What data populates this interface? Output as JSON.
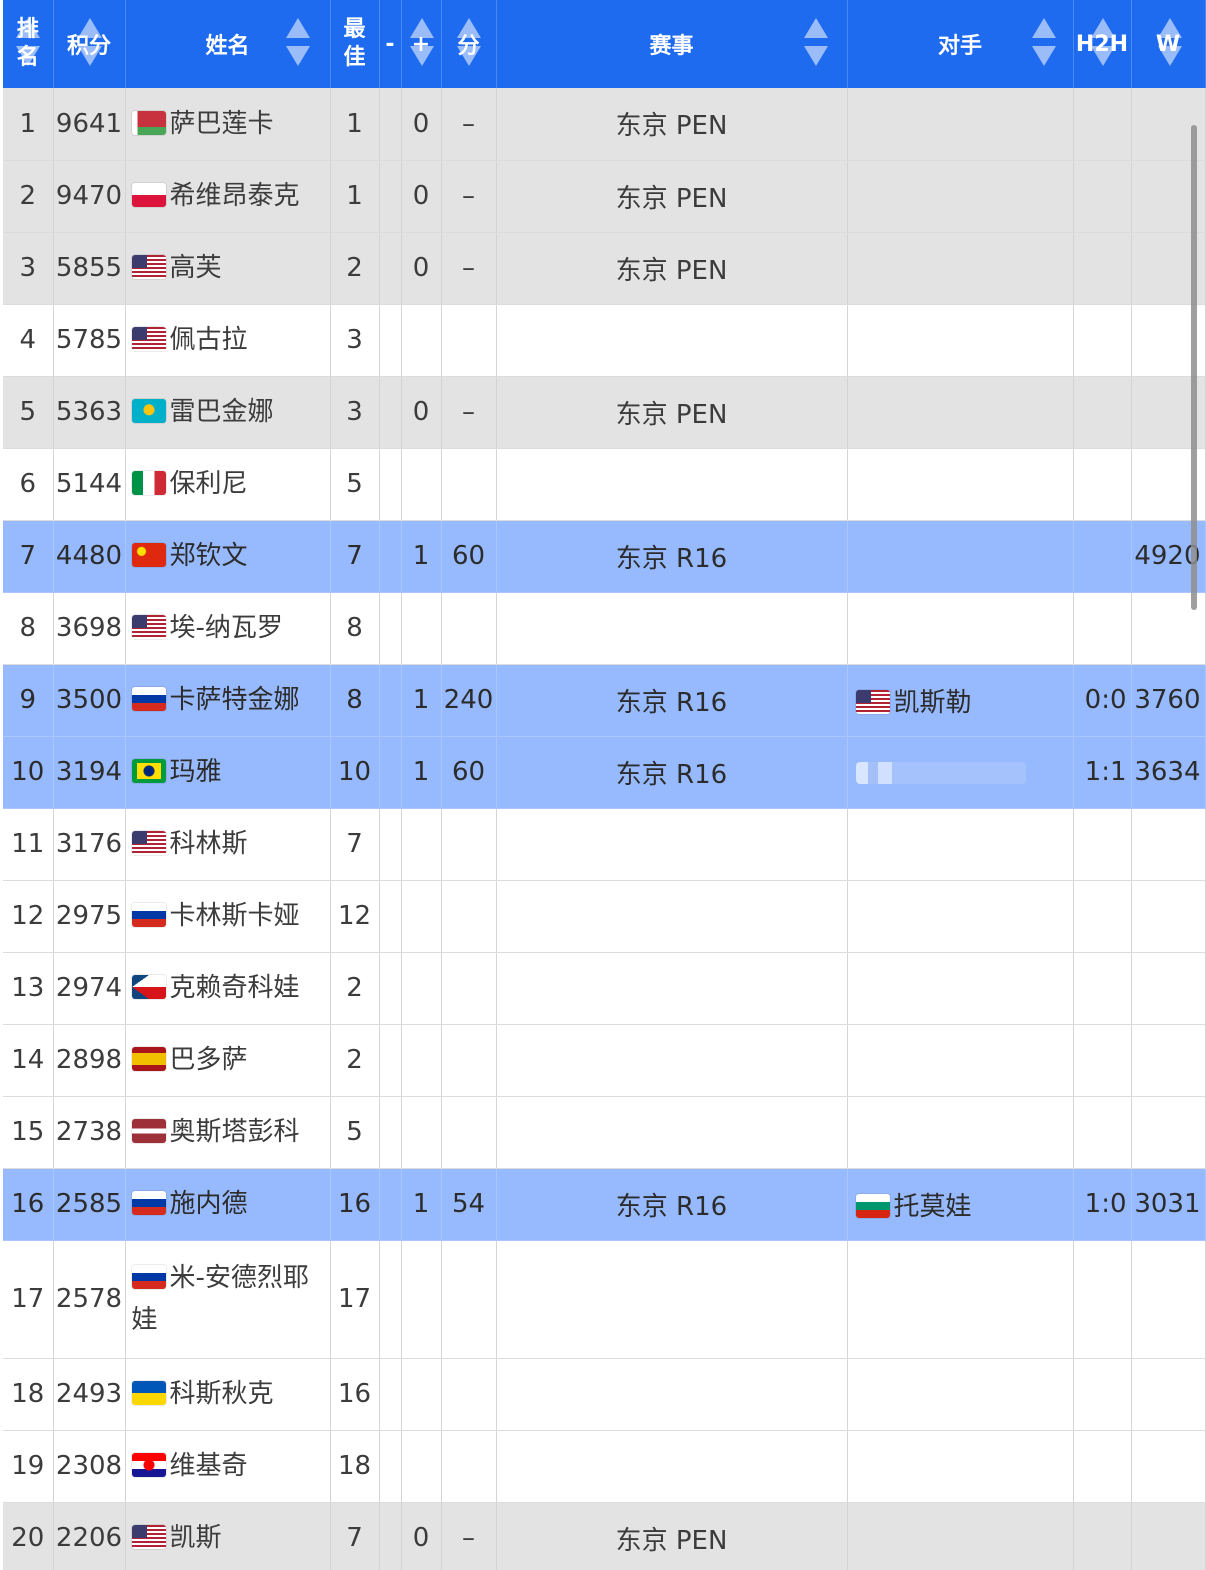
{
  "headers": {
    "rank": "排名",
    "points": "积分",
    "name": "姓名",
    "best": "最佳",
    "change": "-",
    "round": "+",
    "added": "分",
    "event": "赛事",
    "opponent": "对手",
    "h2h": "H2H",
    "w": "W"
  },
  "colors": {
    "header_bg": "#1f6bf0",
    "row_gray": "#e3e3e3",
    "row_white": "#ffffff",
    "row_blue": "#97baff"
  },
  "rows": [
    {
      "rank": "1",
      "points": "9641",
      "flag": "belarus-flag",
      "name": "萨巴莲卡",
      "best": "1",
      "round": "0",
      "added": "–",
      "event": "东京 PEN",
      "opponent": "",
      "h2h": "",
      "w": "",
      "style": "gray"
    },
    {
      "rank": "2",
      "points": "9470",
      "flag": "poland-flag",
      "name": "希维昂泰克",
      "best": "1",
      "round": "0",
      "added": "–",
      "event": "东京 PEN",
      "opponent": "",
      "h2h": "",
      "w": "",
      "style": "gray"
    },
    {
      "rank": "3",
      "points": "5855",
      "flag": "usa-flag",
      "name": "高芙",
      "best": "2",
      "round": "0",
      "added": "–",
      "event": "东京 PEN",
      "opponent": "",
      "h2h": "",
      "w": "",
      "style": "gray"
    },
    {
      "rank": "4",
      "points": "5785",
      "flag": "usa-flag",
      "name": "佩古拉",
      "best": "3",
      "round": "",
      "added": "",
      "event": "",
      "opponent": "",
      "h2h": "",
      "w": "",
      "style": "white"
    },
    {
      "rank": "5",
      "points": "5363",
      "flag": "kazakhstan-flag",
      "name": "雷巴金娜",
      "best": "3",
      "round": "0",
      "added": "–",
      "event": "东京 PEN",
      "opponent": "",
      "h2h": "",
      "w": "",
      "style": "gray"
    },
    {
      "rank": "6",
      "points": "5144",
      "flag": "italy-flag",
      "name": "保利尼",
      "best": "5",
      "round": "",
      "added": "",
      "event": "",
      "opponent": "",
      "h2h": "",
      "w": "",
      "style": "white"
    },
    {
      "rank": "7",
      "points": "4480",
      "flag": "china-flag",
      "name": "郑钦文",
      "best": "7",
      "round": "1",
      "added": "60",
      "event": "东京 R16",
      "opponent": "",
      "h2h": "",
      "w": "4920",
      "style": "blue"
    },
    {
      "rank": "8",
      "points": "3698",
      "flag": "usa-flag",
      "name": "埃-纳瓦罗",
      "best": "8",
      "round": "",
      "added": "",
      "event": "",
      "opponent": "",
      "h2h": "",
      "w": "",
      "style": "white"
    },
    {
      "rank": "9",
      "points": "3500",
      "flag": "russia-flag",
      "name": "卡萨特金娜",
      "best": "8",
      "round": "1",
      "added": "240",
      "event": "东京 R16",
      "opp_flag": "usa-flag",
      "opponent": "凯斯勒",
      "h2h": "0:0",
      "w": "3760",
      "style": "blue"
    },
    {
      "rank": "10",
      "points": "3194",
      "flag": "brazil-flag",
      "name": "玛雅",
      "best": "10",
      "round": "1",
      "added": "60",
      "event": "东京 R16",
      "opp_flag": "blurred",
      "opponent": "",
      "h2h": "1:1",
      "w": "3634",
      "style": "blue"
    },
    {
      "rank": "11",
      "points": "3176",
      "flag": "usa-flag",
      "name": "科林斯",
      "best": "7",
      "round": "",
      "added": "",
      "event": "",
      "opponent": "",
      "h2h": "",
      "w": "",
      "style": "white"
    },
    {
      "rank": "12",
      "points": "2975",
      "flag": "russia-flag",
      "name": "卡林斯卡娅",
      "best": "12",
      "round": "",
      "added": "",
      "event": "",
      "opponent": "",
      "h2h": "",
      "w": "",
      "style": "white"
    },
    {
      "rank": "13",
      "points": "2974",
      "flag": "czech-flag",
      "name": "克赖奇科娃",
      "best": "2",
      "round": "",
      "added": "",
      "event": "",
      "opponent": "",
      "h2h": "",
      "w": "",
      "style": "white"
    },
    {
      "rank": "14",
      "points": "2898",
      "flag": "spain-flag",
      "name": "巴多萨",
      "best": "2",
      "round": "",
      "added": "",
      "event": "",
      "opponent": "",
      "h2h": "",
      "w": "",
      "style": "white"
    },
    {
      "rank": "15",
      "points": "2738",
      "flag": "latvia-flag",
      "name": "奥斯塔彭科",
      "best": "5",
      "round": "",
      "added": "",
      "event": "",
      "opponent": "",
      "h2h": "",
      "w": "",
      "style": "white"
    },
    {
      "rank": "16",
      "points": "2585",
      "flag": "russia-flag",
      "name": "施内德",
      "best": "16",
      "round": "1",
      "added": "54",
      "event": "东京 R16",
      "opp_flag": "bulgaria-flag",
      "opponent": "托莫娃",
      "h2h": "1:0",
      "w": "3031",
      "style": "blue"
    },
    {
      "rank": "17",
      "points": "2578",
      "flag": "russia-flag",
      "name": "米-安德烈耶娃",
      "best": "17",
      "round": "",
      "added": "",
      "event": "",
      "opponent": "",
      "h2h": "",
      "w": "",
      "style": "white",
      "tall": true
    },
    {
      "rank": "18",
      "points": "2493",
      "flag": "ukraine-flag",
      "name": "科斯秋克",
      "best": "16",
      "round": "",
      "added": "",
      "event": "",
      "opponent": "",
      "h2h": "",
      "w": "",
      "style": "white"
    },
    {
      "rank": "19",
      "points": "2308",
      "flag": "croatia-flag",
      "name": "维基奇",
      "best": "18",
      "round": "",
      "added": "",
      "event": "",
      "opponent": "",
      "h2h": "",
      "w": "",
      "style": "white"
    },
    {
      "rank": "20",
      "points": "2206",
      "flag": "usa-flag",
      "name": "凯斯",
      "best": "7",
      "round": "0",
      "added": "–",
      "event": "东京 PEN",
      "opponent": "",
      "h2h": "",
      "w": "",
      "style": "gray"
    }
  ]
}
